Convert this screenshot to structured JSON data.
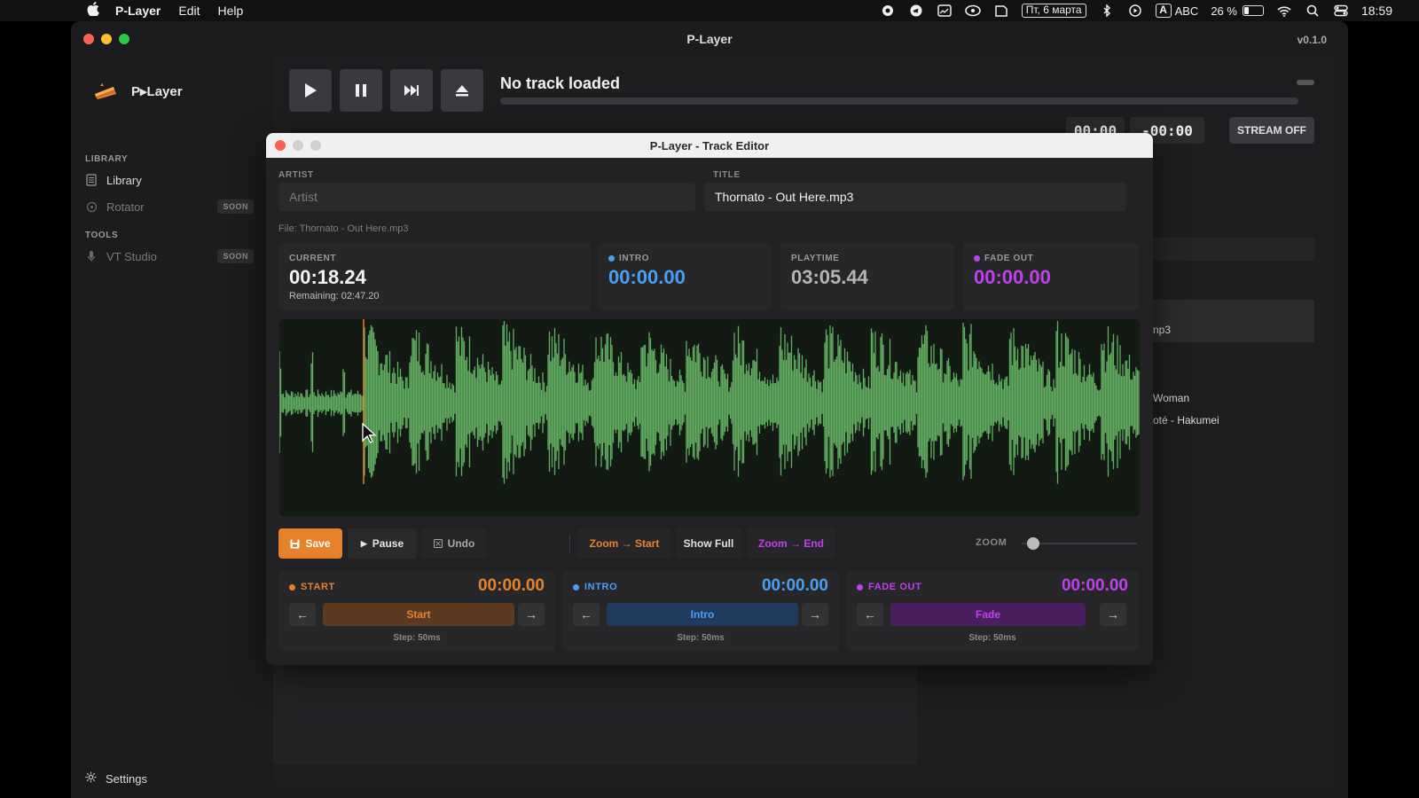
{
  "menubar": {
    "app_name": "P-Layer",
    "menus": [
      "Edit",
      "Help"
    ],
    "date": "Пт, 6 марта",
    "input_source": "A",
    "input_name": "ABC",
    "battery": "26 %",
    "battery_level": 0.26,
    "clock": "18:59"
  },
  "window": {
    "title": "P-Layer",
    "version": "v0.1.0"
  },
  "sidebar": {
    "brand": "P▸Layer",
    "sections": [
      {
        "label": "LIBRARY"
      },
      {
        "label": "TOOLS"
      }
    ],
    "items": [
      {
        "label": "Library",
        "icon": "document-icon"
      },
      {
        "label": "Rotator",
        "icon": "rotator-icon",
        "badge": "SOON"
      },
      {
        "label": "VT Studio",
        "icon": "mic-icon",
        "badge": "SOON"
      }
    ],
    "settings": "Settings"
  },
  "player": {
    "now_playing": "No track loaded",
    "time_elapsed": "00:00",
    "time_remaining": "-00:00",
    "stream_button": "STREAM OFF",
    "bg_list": [
      "np3",
      "Woman",
      "oté - Hakumei"
    ]
  },
  "editor": {
    "title": "P-Layer - Track Editor",
    "artist_label": "ARTIST",
    "artist_placeholder": "Artist",
    "title_label": "TITLE",
    "title_value": "Thornato - Out Here.mp3",
    "file_line": "File: Thornato - Out Here.mp3",
    "stats": {
      "current_label": "CURRENT",
      "current_value": "00:18.24",
      "remaining": "Remaining: 02:47.20",
      "intro_label": "INTRO",
      "intro_value": "00:00.00",
      "playtime_label": "PLAYTIME",
      "playtime_value": "03:05.44",
      "fadeout_label": "FADE OUT",
      "fadeout_value": "00:00.00"
    },
    "controls": {
      "save": "Save",
      "pause": "Pause",
      "undo": "Undo",
      "zoom_start": "Zoom → Start",
      "show_full": "Show Full",
      "zoom_end": "Zoom → End",
      "zoom_label": "ZOOM"
    },
    "markers": [
      {
        "label": "START",
        "value": "00:00.00",
        "button": "Start",
        "step": "Step: 50ms"
      },
      {
        "label": "INTRO",
        "value": "00:00.00",
        "button": "Intro",
        "step": "Step: 50ms"
      },
      {
        "label": "FADE OUT",
        "value": "00:00.00",
        "button": "Fade",
        "step": "Step: 50ms"
      }
    ],
    "colors": {
      "accent_orange": "#e8822a",
      "intro_blue": "#4a9ff5",
      "fade_purple": "#c040f0",
      "wave_green": "#6bbf6a"
    }
  }
}
